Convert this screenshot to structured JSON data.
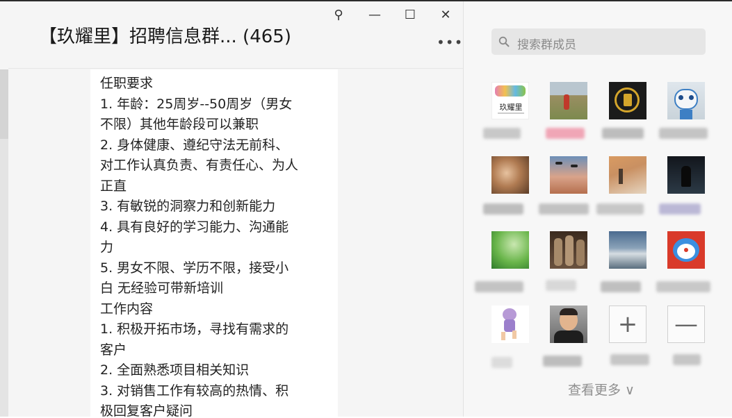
{
  "window": {
    "title": "【玖耀里】招聘信息群... (465)",
    "pin_symbol": "⚲",
    "minimize_symbol": "—",
    "maximize_symbol": "☐",
    "close_symbol": "✕",
    "more_symbol": "•••"
  },
  "message": {
    "lines": [
      "任职要求",
      "1. 年龄：25周岁--50周岁（男女",
      "不限）其他年龄段可以兼职",
      "2. 身体健康、遵纪守法无前科、",
      "对工作认真负责、有责任心、为人",
      "正直",
      "3. 有敏锐的洞察力和创新能力",
      "4. 具有良好的学习能力、沟通能",
      "力",
      "5. 男女不限、学历不限，接受小",
      "白 无经验可带新培训",
      "工作内容",
      "1. 积极开拓市场，寻找有需求的",
      "客户",
      "2. 全面熟悉项目相关知识",
      "3. 对销售工作有较高的热情、积",
      "极回复客户疑问"
    ]
  },
  "sidebar": {
    "search_placeholder": "搜索群成员",
    "logo_text": "玖耀里",
    "add_symbol": "+",
    "remove_symbol": "—",
    "view_more": "查看更多 ∨"
  },
  "colors": {
    "chat_bg": "#f5f5f5",
    "sidebar_bg": "#f7f7f7",
    "bubble_bg": "#ffffff",
    "search_bg": "#e6e6e6"
  }
}
